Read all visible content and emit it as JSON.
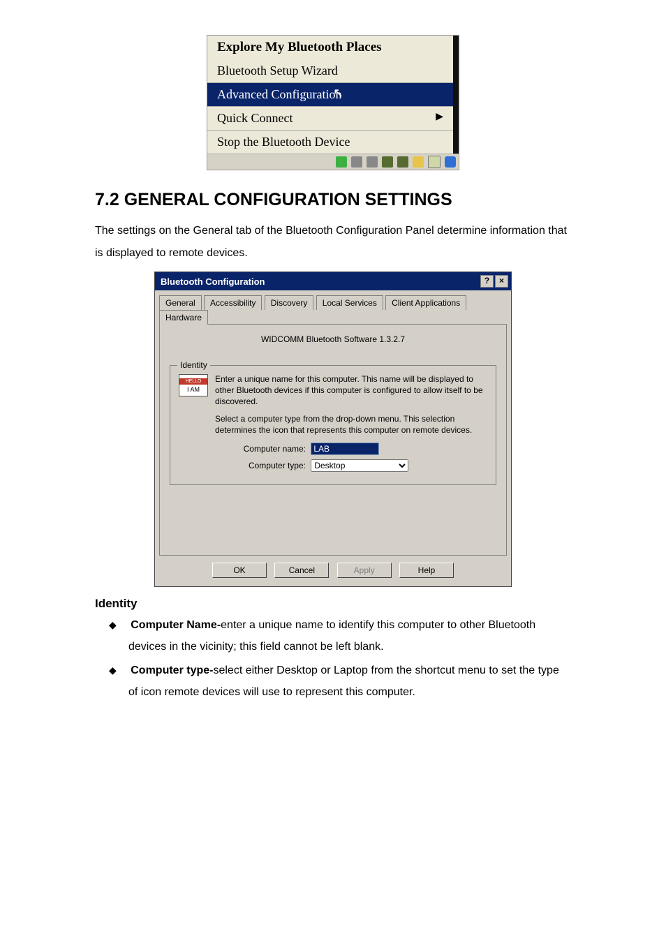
{
  "context_menu": {
    "line1_bold": "Explore My Bluetooth Places",
    "line2": "Bluetooth Setup Wizard",
    "highlighted": "Advanced Configuration",
    "line4": "Quick Connect",
    "line5": "Stop the Bluetooth Device"
  },
  "section_heading": "7.2 GENERAL CONFIGURATION SETTINGS",
  "section_intro": "The settings on the General tab of the Bluetooth Configuration Panel determine information that is displayed to remote devices.",
  "dialog": {
    "title": "Bluetooth Configuration",
    "tabs": [
      "General",
      "Accessibility",
      "Discovery",
      "Local Services",
      "Client Applications",
      "Hardware"
    ],
    "active_tab_index": 0,
    "software_line": "WIDCOMM Bluetooth Software 1.3.2.7",
    "identity": {
      "legend": "Identity",
      "icon_hello": "HELLO",
      "icon_iam": "I AM",
      "para1": "Enter a unique name for this computer.  This name will be displayed to other Bluetooth devices if this computer is configured to allow itself to be discovered.",
      "para2": "Select a computer type from the drop-down menu.  This selection determines the icon that represents this computer on remote devices.",
      "name_label": "Computer name:",
      "name_value": "LAB",
      "type_label": "Computer type:",
      "type_value": "Desktop"
    },
    "buttons": {
      "ok": "OK",
      "cancel": "Cancel",
      "apply": "Apply",
      "help": "Help"
    },
    "winbtn_help": "?",
    "winbtn_close": "×"
  },
  "subheading": "Identity",
  "bullets": [
    {
      "bold": "Computer Name-",
      "rest": "enter a unique name to identify this computer to other Bluetooth devices in the vicinity; this field cannot be left blank."
    },
    {
      "bold": "Computer type-",
      "rest": "select either Desktop or Laptop from the shortcut menu to set the type of icon remote devices will use to represent this computer."
    }
  ]
}
